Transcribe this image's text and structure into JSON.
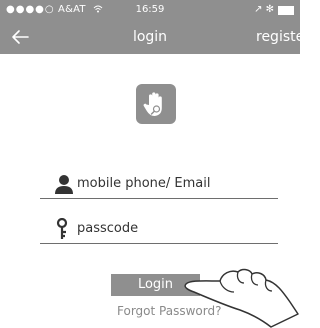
{
  "status_bar": {
    "signal_dots": "●●●●○",
    "carrier": "A&AT",
    "wifi_icon": "wifi-icon",
    "time": "16:59",
    "right_icons": "↗ ✻",
    "battery_icon": "battery-icon"
  },
  "nav": {
    "back_icon": "arrow-left-icon",
    "title": "login",
    "register_label": "registe"
  },
  "logo": {
    "icon": "hand-stop-icon"
  },
  "form": {
    "account_placeholder": "mobile phone/ Email",
    "account_icon": "user-icon",
    "passcode_placeholder": "passcode",
    "passcode_icon": "key-icon"
  },
  "actions": {
    "login_label": "Login",
    "forgot_label": "Forgot Password?"
  },
  "colors": {
    "bar": "#8f8f8f",
    "text": "#333333",
    "link": "#8a8a8a",
    "white": "#ffffff"
  }
}
